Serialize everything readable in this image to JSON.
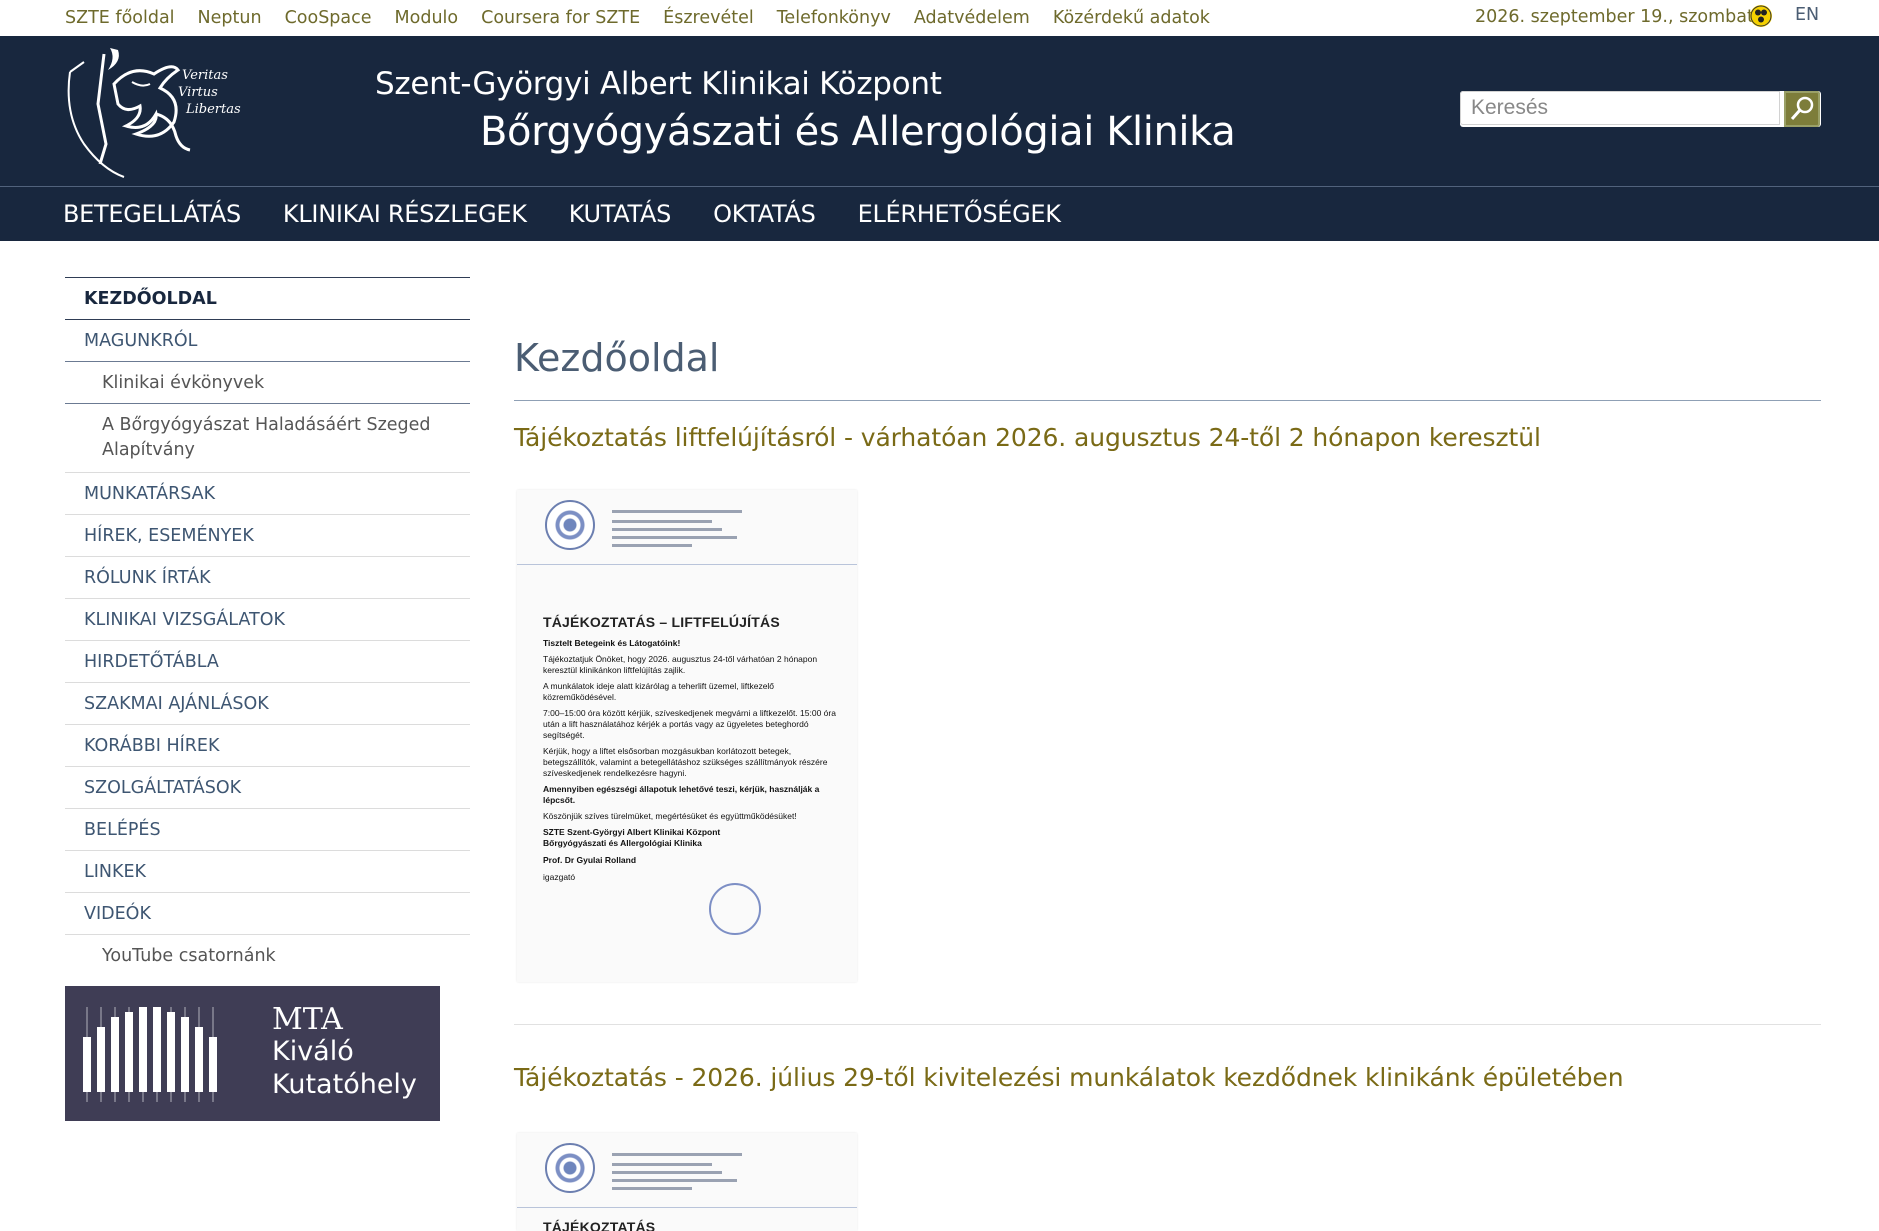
{
  "topbar": {
    "links": [
      "SZTE főoldal",
      "Neptun",
      "CooSpace",
      "Modulo",
      "Coursera for SZTE",
      "Észrevétel",
      "Telefonkönyv",
      "Adatvédelem",
      "Közérdekű adatok"
    ],
    "date": "2026. szeptember 19., szombat",
    "language": "EN",
    "accessibility_icon": "contrast-icon"
  },
  "header": {
    "logo_motto": [
      "Veritas",
      "Virtus",
      "Libertas"
    ],
    "subtitle": "Szent-Györgyi Albert Klinikai Központ",
    "title": "Bőrgyógyászati és Allergológiai Klinika",
    "search_placeholder": "Keresés",
    "search_icon": "magnifier-icon",
    "background_color": "#18273e"
  },
  "mainnav": [
    "BETEGELLÁTÁS",
    "KLINIKAI RÉSZLEGEK",
    "KUTATÁS",
    "OKTATÁS",
    "ELÉRHETŐSÉGEK"
  ],
  "sidebar": {
    "items": [
      {
        "label": "KEZDŐOLDAL",
        "active": true
      },
      {
        "label": "MAGUNKRÓL"
      },
      {
        "label": "Klinikai évkönyvek",
        "sub": true
      },
      {
        "label": "A Bőrgyógyászat Haladásáért Szeged Alapítvány",
        "sub": true
      },
      {
        "label": "MUNKATÁRSAK"
      },
      {
        "label": "HÍREK, ESEMÉNYEK"
      },
      {
        "label": "RÓLUNK ÍRTÁK"
      },
      {
        "label": "KLINIKAI VIZSGÁLATOK"
      },
      {
        "label": "HIRDETŐTÁBLA"
      },
      {
        "label": "SZAKMAI AJÁNLÁSOK"
      },
      {
        "label": "KORÁBBI HÍREK"
      },
      {
        "label": "SZOLGÁLTATÁSOK"
      },
      {
        "label": "BELÉPÉS"
      },
      {
        "label": "LINKEK"
      },
      {
        "label": "VIDEÓK"
      },
      {
        "label": "YouTube csatornánk",
        "sub": true
      }
    ],
    "banner": {
      "line1": "MTA",
      "line2": "Kiváló",
      "line3": "Kutatóhely"
    }
  },
  "content": {
    "page_title": "Kezdőoldal",
    "news": [
      {
        "title": "Tájékoztatás liftfelújításról - várhatóan 2026. augusztus 24-től 2 hónapon keresztül",
        "notice_title": "TÁJÉKOZTATÁS – LIFTFELÚJÍTÁS",
        "notice_greeting": "Tisztelt Betegeink és Látogatóink!",
        "notice_p1": "Tájékoztatjuk Önöket, hogy 2026. augusztus 24-től várhatóan 2 hónapon keresztül klinikánkon liftfelújítás zajlik.",
        "notice_p2": "A munkálatok ideje alatt kizárólag a teherlift üzemel, liftkezelő közreműködésével.",
        "notice_p3": "7:00–15:00 óra között kérjük, szíveskedjenek megvárni a liftkezelőt. 15:00 óra után a lift használatához kérjék a portás vagy az ügyeletes beteghordó segítségét.",
        "notice_p4": "Kérjük, hogy a liftet elsősorban mozgásukban korlátozott betegek, betegszállítók, valamint a betegellátáshoz szükséges szállítmányok részére szíveskedjenek rendelkezésre hagyni.",
        "notice_p5": "Amennyiben egészségi állapotuk lehetővé teszi, kérjük, használják a lépcsőt.",
        "notice_p6": "Köszönjük szíves türelmüket, megértésüket és együttműködésüket!",
        "notice_sign1": "SZTE Szent-Györgyi Albert Klinikai Központ",
        "notice_sign2": "Bőrgyógyászati és Allergológiai Klinika",
        "notice_sign3": "Prof. Dr Gyulai Rolland",
        "notice_sign4": "igazgató"
      },
      {
        "title": "Tájékoztatás - 2026. július 29-től kivitelezési munkálatok kezdődnek klinikánk épületében",
        "notice_title": "TÁJÉKOZTATÁS"
      }
    ]
  }
}
